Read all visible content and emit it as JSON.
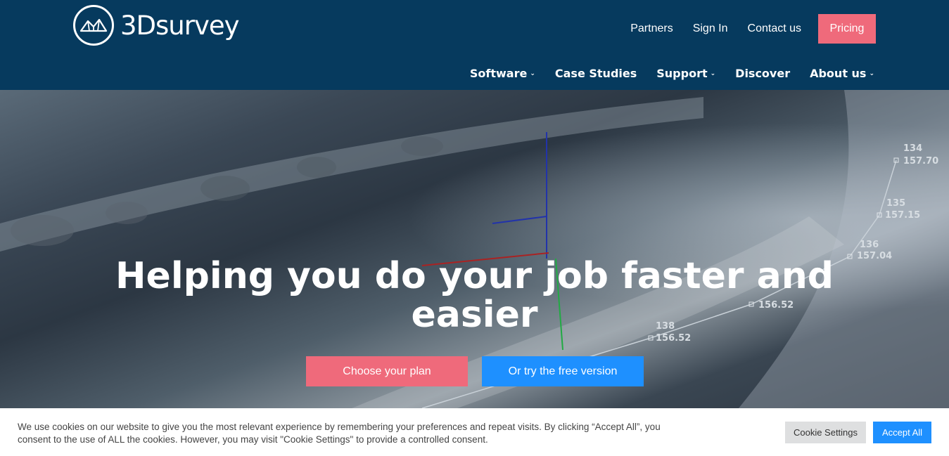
{
  "brand": {
    "name": "3Dsurvey"
  },
  "top_nav": {
    "partners": "Partners",
    "sign_in": "Sign In",
    "contact": "Contact us",
    "pricing": "Pricing"
  },
  "main_nav": {
    "software": "Software",
    "case_studies": "Case Studies",
    "support": "Support",
    "discover": "Discover",
    "about": "About us"
  },
  "hero": {
    "title_line1": "Helping you do your job faster and",
    "title_line2": "easier",
    "choose_plan": "Choose your plan",
    "free_version": "Or try the free version",
    "survey_labels": [
      "134",
      "157.70",
      "135",
      "157.15",
      "136",
      "157.04",
      "156.52",
      "138",
      "156.52"
    ]
  },
  "cookie": {
    "text": "We use cookies on our website to give you the most relevant experience by remembering your preferences and repeat visits. By clicking “Accept All”, you consent to the use of ALL the cookies. However, you may visit \"Cookie Settings\" to provide a controlled consent.",
    "settings": "Cookie Settings",
    "accept": "Accept All"
  },
  "colors": {
    "header_bg": "#063a5e",
    "pink": "#ef6a7b",
    "blue": "#1e90ff"
  }
}
